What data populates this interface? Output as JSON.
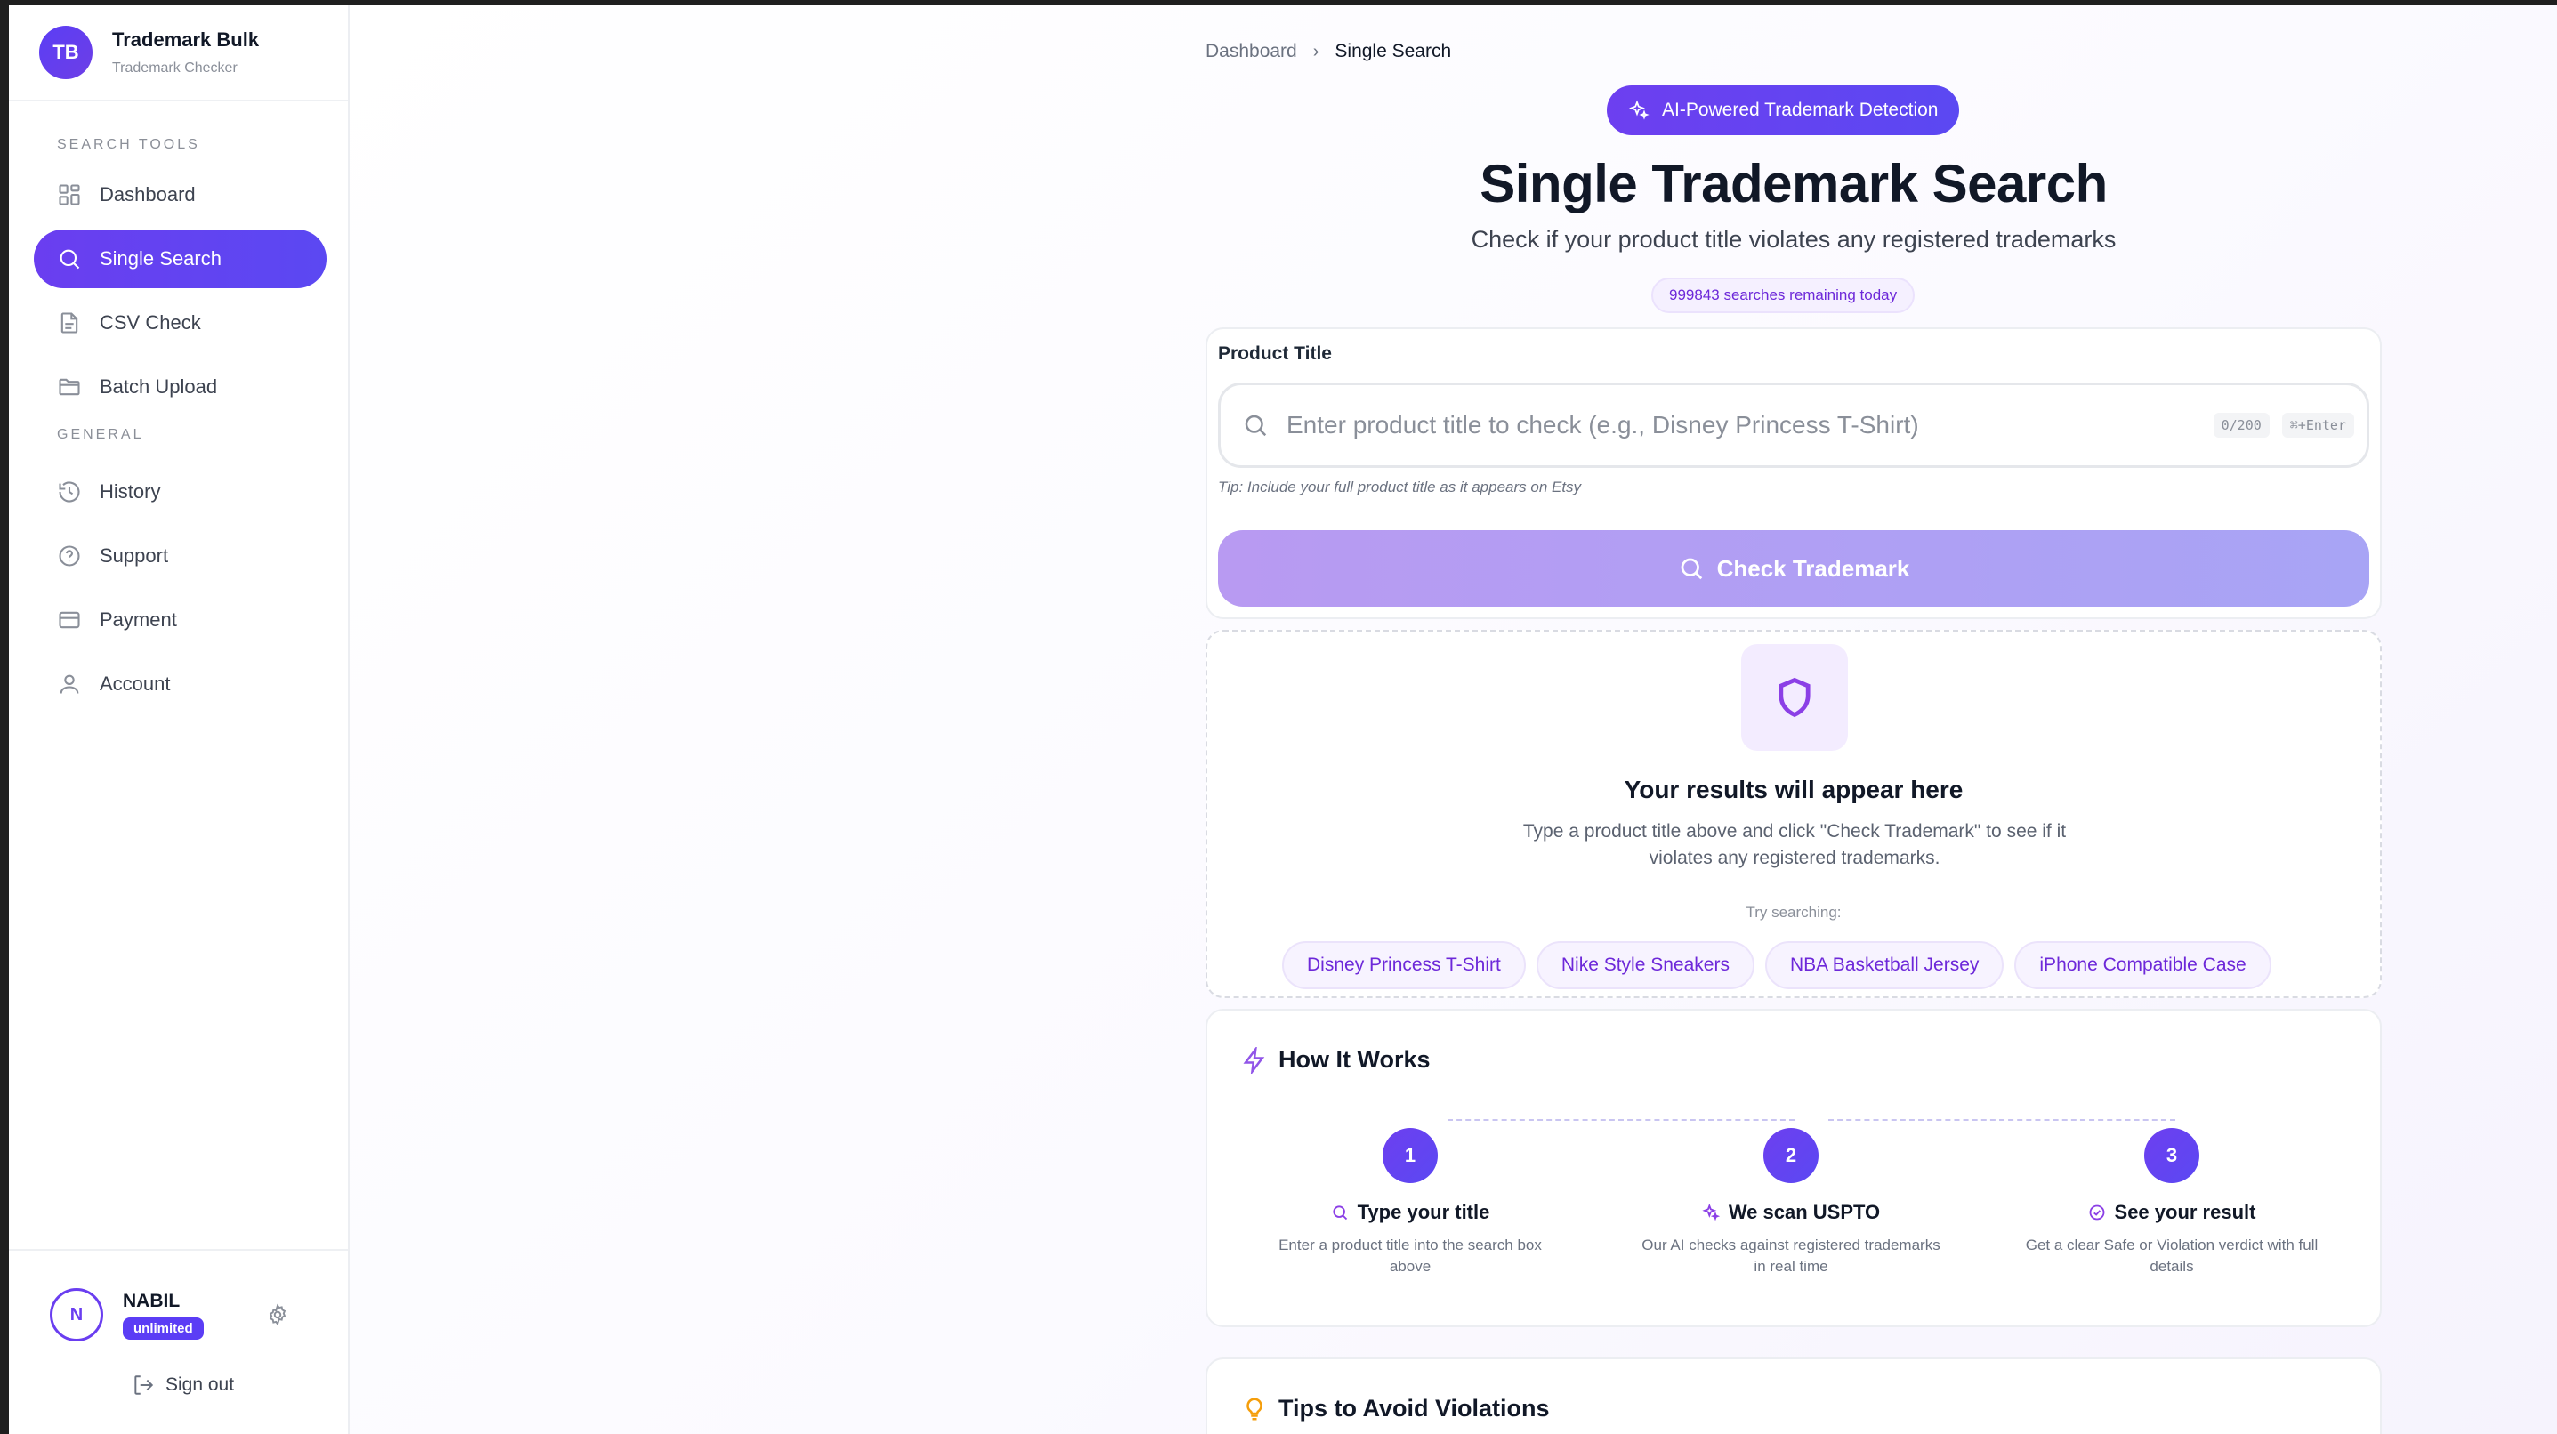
{
  "brand": {
    "initials": "TB",
    "title": "Trademark Bulk",
    "subtitle": "Trademark Checker"
  },
  "sidebar": {
    "section_search_tools": "SEARCH TOOLS",
    "section_general": "GENERAL",
    "items": [
      {
        "label": "Dashboard",
        "icon": "grid-icon"
      },
      {
        "label": "Single Search",
        "icon": "search-icon",
        "active": true
      },
      {
        "label": "CSV Check",
        "icon": "file-icon"
      },
      {
        "label": "Batch Upload",
        "icon": "folder-icon"
      },
      {
        "label": "History",
        "icon": "history-icon"
      },
      {
        "label": "Support",
        "icon": "help-circle-icon"
      },
      {
        "label": "Payment",
        "icon": "credit-card-icon"
      },
      {
        "label": "Account",
        "icon": "user-icon"
      }
    ],
    "user": {
      "initial": "N",
      "name": "NABIL",
      "plan": "unlimited"
    },
    "sign_out": "Sign out"
  },
  "breadcrumb": {
    "parent": "Dashboard",
    "current": "Single Search"
  },
  "hero": {
    "badge": "AI-Powered Trademark Detection",
    "title": "Single Trademark Search",
    "subtitle": "Check if your product title violates any registered trademarks",
    "remaining": "999843 searches remaining today"
  },
  "search": {
    "label": "Product Title",
    "placeholder": "Enter product title to check (e.g., Disney Princess T-Shirt)",
    "value": "",
    "char_count": "0/200",
    "shortcut": "⌘+Enter",
    "tip": "Tip: Include your full product title as it appears on Etsy",
    "button": "Check Trademark"
  },
  "results": {
    "title": "Your results will appear here",
    "description": "Type a product title above and click \"Check Trademark\" to see if it violates any registered trademarks.",
    "try_label": "Try searching:",
    "examples": [
      "Disney Princess T-Shirt",
      "Nike Style Sneakers",
      "NBA Basketball Jersey",
      "iPhone Compatible Case"
    ]
  },
  "how": {
    "title": "How It Works",
    "steps": [
      {
        "num": "1",
        "title": "Type your title",
        "desc": "Enter a product title into the search box above"
      },
      {
        "num": "2",
        "title": "We scan USPTO",
        "desc": "Our AI checks against registered trademarks in real time"
      },
      {
        "num": "3",
        "title": "See your result",
        "desc": "Get a clear Safe or Violation verdict with full details"
      }
    ]
  },
  "tips": {
    "title": "Tips to Avoid Violations"
  },
  "colors": {
    "accent": "#5b3df5",
    "accent_light": "#f5f0ff",
    "button_disabled": "#b89af2"
  }
}
